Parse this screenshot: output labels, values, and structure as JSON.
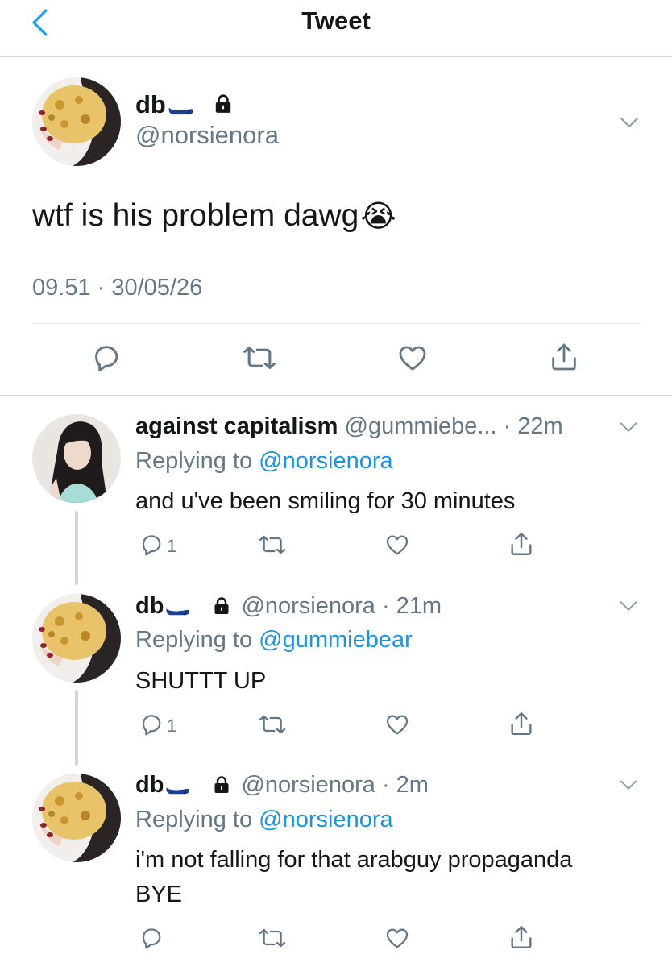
{
  "nav": {
    "title": "Tweet",
    "back_icon": "chevron-left-icon"
  },
  "main_tweet": {
    "display_name": "db",
    "handle": "@norsienora",
    "protected_icon": "lock-icon",
    "text": "wtf is his problem dawg",
    "emoji": "😭",
    "timestamp": "09.51 · 30/05/26",
    "actions": [
      "reply-icon",
      "retweet-icon",
      "like-icon",
      "share-icon"
    ]
  },
  "replies": [
    {
      "display_name": "against capitalism",
      "handle_time": "@gummiebe... · 22m",
      "replying_prefix": "Replying to",
      "replying_to": "@norsienora",
      "text": "and u've been smiling for 30 minutes",
      "reply_count": "1",
      "protected": false
    },
    {
      "display_name": "db",
      "handle_time": "@norsienora · 21m",
      "replying_prefix": "Replying to",
      "replying_to": "@gummiebear",
      "text": "SHUTTT UP",
      "reply_count": "1",
      "protected": true
    },
    {
      "display_name": "db",
      "handle_time": "@norsienora · 2m",
      "replying_prefix": "Replying to",
      "replying_to": "@norsienora",
      "text_line1": "i'm not falling for that arabguy propaganda",
      "text_line2": "BYE",
      "reply_count": "",
      "protected": true
    }
  ],
  "colors": {
    "accent": "#1b95e0",
    "muted": "#657786",
    "text": "#14171a",
    "divider": "#e1e8ed",
    "thread_line": "#ccd6dd"
  }
}
